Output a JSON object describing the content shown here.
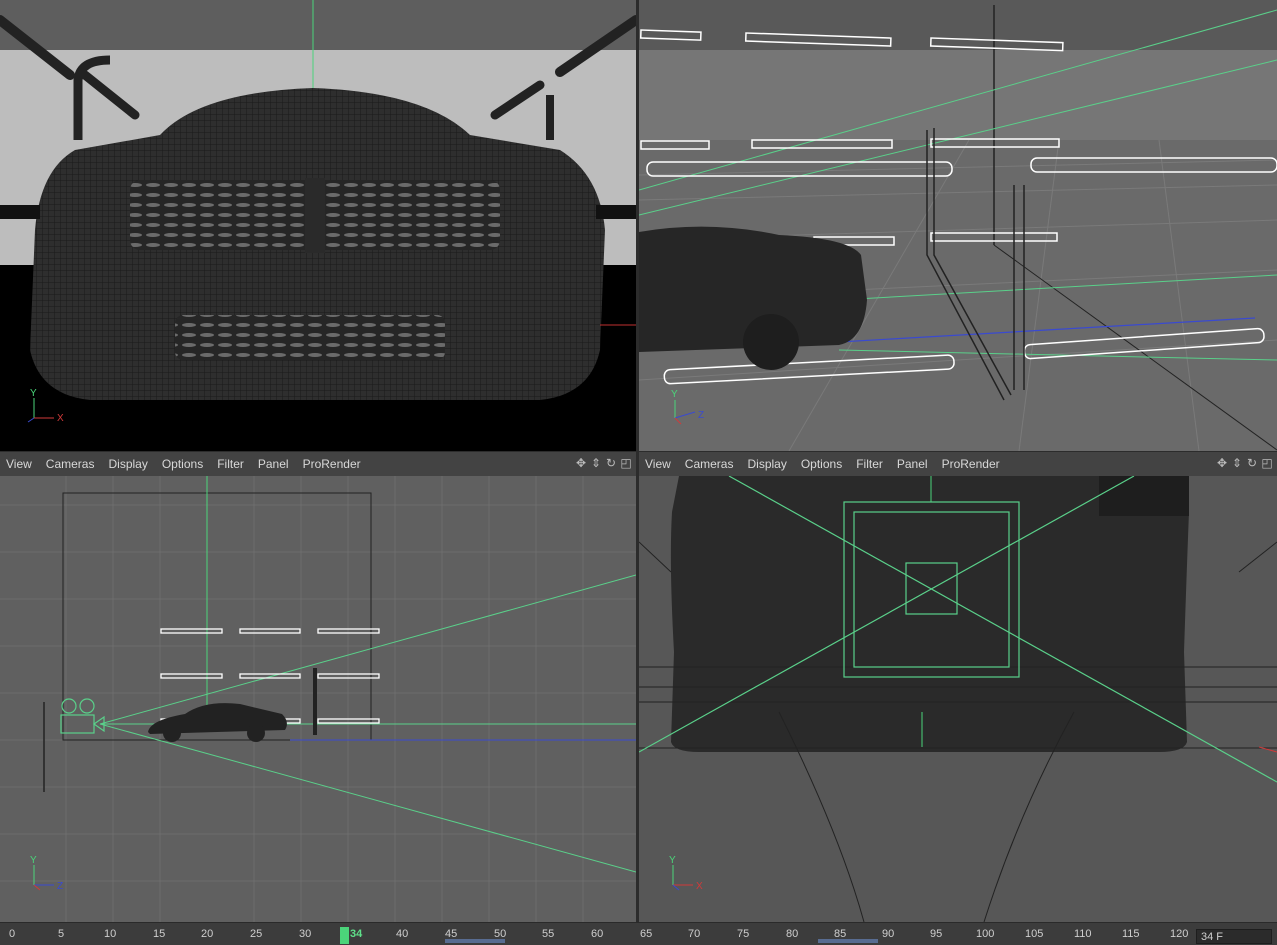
{
  "viewport_menu": {
    "items": [
      "View",
      "Cameras",
      "Display",
      "Options",
      "Filter",
      "Panel",
      "ProRender"
    ]
  },
  "axes": {
    "front": {
      "v": "Y",
      "h": "X"
    },
    "perspective": {
      "v": "Y",
      "h": "Z"
    },
    "right": {
      "v": "Y",
      "h": "Z"
    },
    "top_view": {
      "v": "Y",
      "h": "X"
    }
  },
  "timeline": {
    "ticks": [
      "0",
      "5",
      "10",
      "15",
      "20",
      "25",
      "30",
      "40",
      "45",
      "50",
      "55",
      "60",
      "65",
      "70",
      "75",
      "80",
      "85",
      "90",
      "95",
      "100",
      "105",
      "110",
      "115",
      "120"
    ],
    "current_frame": "34",
    "frame_field": "34 F"
  },
  "colors": {
    "accent_green": "#4bd47a",
    "guide_green": "#5ad08a",
    "axis_blue": "#3a4ad0",
    "axis_red": "#d03a3a"
  },
  "icons": {
    "move": "move-icon",
    "scale": "scale-icon",
    "rotate": "rotate-icon",
    "maximize": "maximize-icon"
  }
}
